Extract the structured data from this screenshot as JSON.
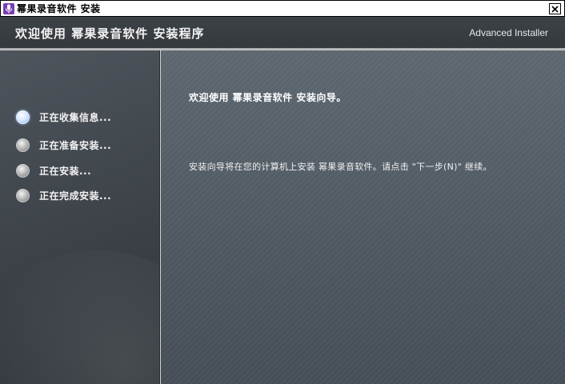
{
  "window": {
    "title": "幂果录音软件 安装",
    "close_symbol": "x"
  },
  "header": {
    "title": "欢迎使用 幂果录音软件 安装程序",
    "brand": "Advanced Installer"
  },
  "steps": [
    {
      "label": "正在收集信息...",
      "active": true
    },
    {
      "label": "正在准备安装...",
      "active": false
    },
    {
      "label": "正在安装...",
      "active": false
    },
    {
      "label": "正在完成安装...",
      "active": false
    }
  ],
  "content": {
    "heading": "欢迎使用 幂果录音软件 安装向导。",
    "body": "安装向导将在您的计算机上安装 幂果录音软件。请点击 \"下一步(N)\" 继续。"
  },
  "colors": {
    "header_bg": "#3d4247",
    "sidebar_bg": "#454c53",
    "content_bg": "#54606a",
    "app_icon": "#7a3db0"
  }
}
